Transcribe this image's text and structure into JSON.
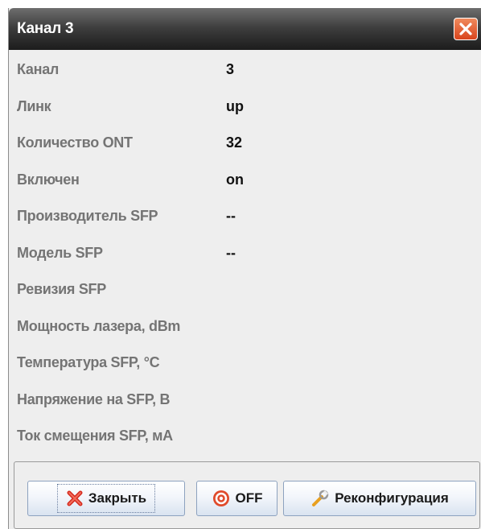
{
  "window": {
    "title": "Канал 3",
    "close_icon": "close-icon"
  },
  "properties": [
    {
      "label": "Канал",
      "value": "3"
    },
    {
      "label": "Линк",
      "value": "up"
    },
    {
      "label": "Количество ONT",
      "value": "32"
    },
    {
      "label": "Включен",
      "value": "on"
    },
    {
      "label": "Производитель SFP",
      "value": "--"
    },
    {
      "label": "Модель SFP",
      "value": "--"
    },
    {
      "label": "Ревизия SFP",
      "value": ""
    },
    {
      "label": "Мощность лазера, dBm",
      "value": ""
    },
    {
      "label": "Температура SFP, °C",
      "value": ""
    },
    {
      "label": "Напряжение на SFP, В",
      "value": ""
    },
    {
      "label": "Ток смещения SFP, мА",
      "value": ""
    }
  ],
  "buttons": {
    "close_label": "Закрыть",
    "off_label": "OFF",
    "reconfigure_label": "Реконфигурация"
  },
  "colors": {
    "titlebar": "#1c1c1c",
    "close_button": "#d9441c",
    "label_text": "#747474",
    "value_text": "#111111",
    "background": "#eeeeee"
  }
}
